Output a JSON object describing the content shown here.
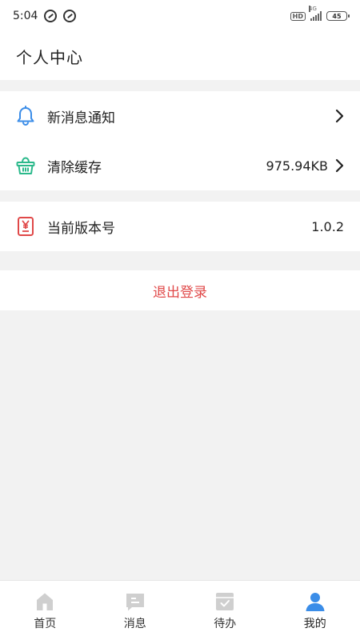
{
  "status_bar": {
    "time": "5:04",
    "hd_label": "HD",
    "network_label": "4G",
    "battery_level": "45"
  },
  "header": {
    "title": "个人中心"
  },
  "settings": {
    "notifications_label": "新消息通知",
    "clear_cache_label": "清除缓存",
    "cache_size": "975.94KB",
    "version_label": "当前版本号",
    "version_value": "1.0.2"
  },
  "logout_label": "退出登录",
  "tabs": [
    {
      "label": "首页",
      "icon": "home-icon",
      "active": false
    },
    {
      "label": "消息",
      "icon": "message-icon",
      "active": false
    },
    {
      "label": "待办",
      "icon": "todo-icon",
      "active": false
    },
    {
      "label": "我的",
      "icon": "user-icon",
      "active": true
    }
  ],
  "colors": {
    "bell": "#3b8de8",
    "basket": "#2bb98b",
    "version": "#e04848",
    "logout": "#e04848",
    "tab_inactive": "#cfcfcf",
    "tab_active": "#3b8de8",
    "background": "#f2f2f2"
  }
}
